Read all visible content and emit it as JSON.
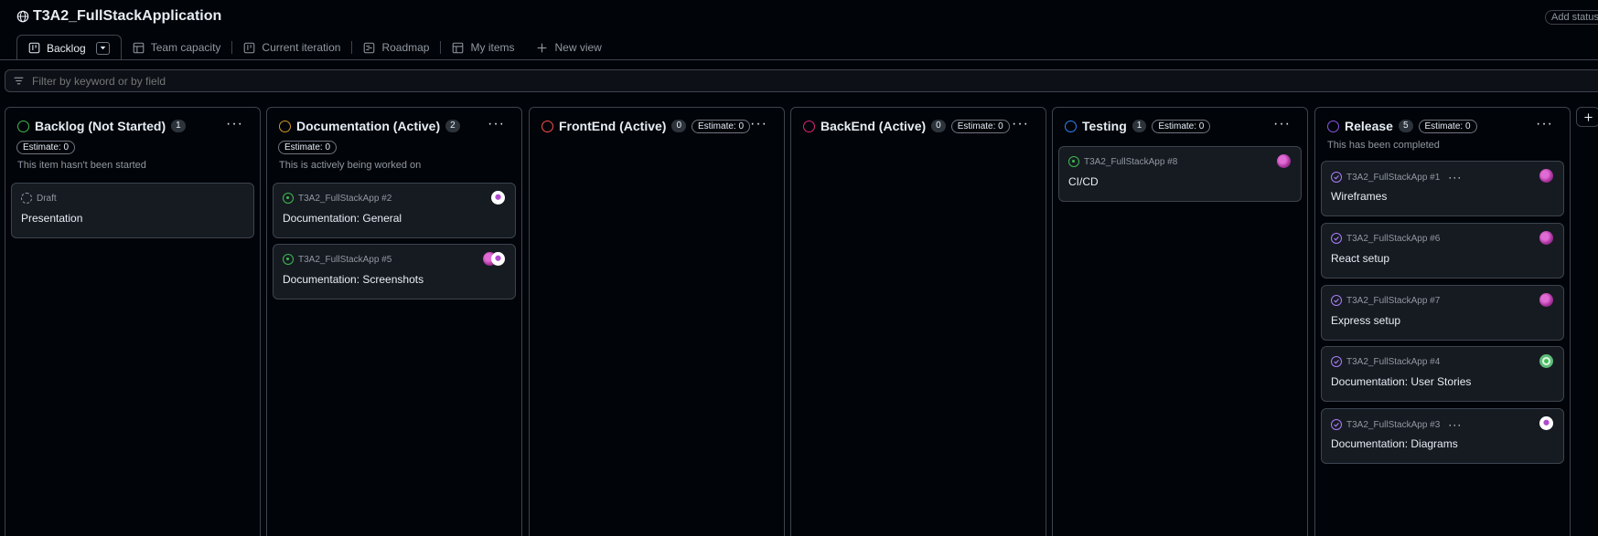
{
  "project": {
    "title": "T3A2_FullStackApplication",
    "add_status_label": "Add status"
  },
  "tabs": [
    {
      "label": "Backlog",
      "icon": "board-icon",
      "active": true
    },
    {
      "label": "Team capacity",
      "icon": "table-icon"
    },
    {
      "label": "Current iteration",
      "icon": "board-icon"
    },
    {
      "label": "Roadmap",
      "icon": "roadmap-icon"
    },
    {
      "label": "My items",
      "icon": "table-icon"
    },
    {
      "label": "New view",
      "icon": "plus-icon"
    }
  ],
  "filter": {
    "placeholder": "Filter by keyword or by field"
  },
  "columns": [
    {
      "name": "Backlog (Not Started)",
      "count": "1",
      "estimate": "Estimate: 0",
      "description": "This item hasn't been started",
      "color": "#3fb950",
      "cards": [
        {
          "type": "draft",
          "meta": "Draft",
          "title": "Presentation"
        }
      ]
    },
    {
      "name": "Documentation (Active)",
      "count": "2",
      "estimate": "Estimate: 0",
      "description": "This is actively being worked on",
      "color": "#d29922",
      "cards": [
        {
          "type": "open",
          "meta": "T3A2_FullStackApp #2",
          "title": "Documentation: General"
        },
        {
          "type": "open",
          "meta": "T3A2_FullStackApp #5",
          "title": "Documentation: Screenshots"
        }
      ]
    },
    {
      "name": "FrontEnd (Active)",
      "count": "0",
      "estimate": "Estimate: 0",
      "color": "#f85149",
      "cards": []
    },
    {
      "name": "BackEnd (Active)",
      "count": "0",
      "estimate": "Estimate: 0",
      "color": "#db2777",
      "cards": []
    },
    {
      "name": "Testing",
      "count": "1",
      "estimate": "Estimate: 0",
      "color": "#2f81f7",
      "cards": [
        {
          "type": "open",
          "meta": "T3A2_FullStackApp #8",
          "title": "CI/CD"
        }
      ]
    },
    {
      "name": "Release",
      "count": "5",
      "estimate": "Estimate: 0",
      "description": "This has been completed",
      "color": "#8957e5",
      "cards": [
        {
          "type": "done",
          "meta": "T3A2_FullStackApp #1",
          "title": "Wireframes"
        },
        {
          "type": "done",
          "meta": "T3A2_FullStackApp #6",
          "title": "React setup"
        },
        {
          "type": "done",
          "meta": "T3A2_FullStackApp #7",
          "title": "Express setup"
        },
        {
          "type": "done",
          "meta": "T3A2_FullStackApp #4",
          "title": "Documentation: User Stories"
        },
        {
          "type": "done",
          "meta": "T3A2_FullStackApp #3",
          "title": "Documentation: Diagrams"
        }
      ]
    }
  ],
  "more_glyph": "···"
}
